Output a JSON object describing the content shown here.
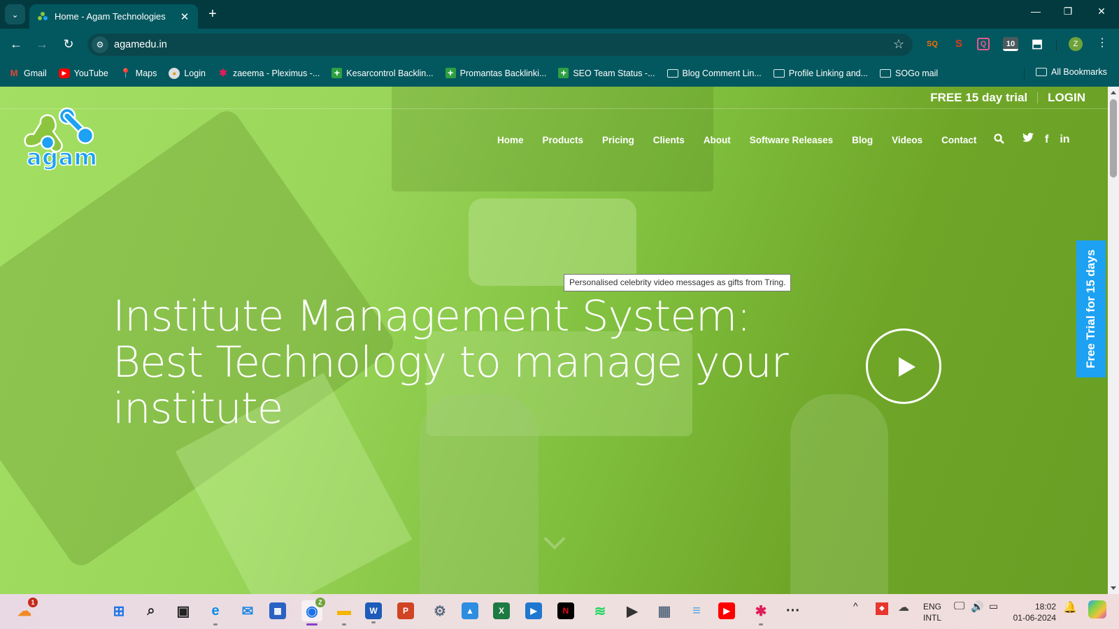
{
  "browser": {
    "tab": {
      "title": "Home - Agam Technologies",
      "close_icon": "close-icon"
    },
    "new_tab_label": "+",
    "window_controls": {
      "minimize": "—",
      "restore": "❐",
      "close": "✕"
    },
    "toolbar": {
      "back": "←",
      "forward": "→",
      "reload": "↻",
      "url": "agamedu.in",
      "star": "☆",
      "extensions": [
        {
          "name": "sq-extension",
          "label": "SQ",
          "color": "#ff6a00"
        },
        {
          "name": "seo-extension",
          "label": "S",
          "color": "#e43a1a"
        },
        {
          "name": "search-extension",
          "label": "Q",
          "color": "#e8598f"
        },
        {
          "name": "ten-extension",
          "label": "10",
          "color": "#ffffff"
        }
      ],
      "puzzle_icon": "⬒",
      "profile_initial": "Z",
      "menu": "⋮"
    },
    "bookmarks": [
      {
        "label": "Gmail",
        "icon": "gmail-icon"
      },
      {
        "label": "YouTube",
        "icon": "youtube-icon"
      },
      {
        "label": "Maps",
        "icon": "maps-icon"
      },
      {
        "label": "Login",
        "icon": "login-icon"
      },
      {
        "label": "zaeema - Pleximus -...",
        "icon": "slack-icon"
      },
      {
        "label": "Kesarcontrol Backlin...",
        "icon": "sheets-plus-icon"
      },
      {
        "label": "Promantas Backlinki...",
        "icon": "sheets-plus-icon"
      },
      {
        "label": "SEO Team Status -...",
        "icon": "sheets-plus-icon"
      },
      {
        "label": "Blog Comment Lin...",
        "icon": "folder-icon"
      },
      {
        "label": "Profile Linking and...",
        "icon": "folder-icon"
      },
      {
        "label": "SOGo mail",
        "icon": "folder-icon"
      }
    ],
    "all_bookmarks": "All Bookmarks"
  },
  "site": {
    "top_links": {
      "trial": "FREE 15 day trial",
      "login": "LOGIN"
    },
    "logo_text": "agam",
    "nav": [
      "Home",
      "Products",
      "Pricing",
      "Clients",
      "About",
      "Software Releases",
      "Blog",
      "Videos",
      "Contact"
    ],
    "socials": {
      "twitter": "🐦",
      "facebook": "f",
      "linkedin": "in"
    },
    "hero_lines": [
      "Institute Management System:",
      "Best Technology to manage your",
      "institute"
    ],
    "tooltip": "Personalised celebrity video messages as gifts from Tring.",
    "side_tab": "Free Trial for 15 days",
    "colors": {
      "accent_blue": "#1da1f2",
      "hero_green": "#8cc63f"
    }
  },
  "taskbar": {
    "weather_badge": "1",
    "apps": [
      {
        "name": "start",
        "glyph": "⊞",
        "color": "#1a73e8"
      },
      {
        "name": "search",
        "glyph": "⌕",
        "color": "#222"
      },
      {
        "name": "task-view",
        "glyph": "▣",
        "color": "#222"
      },
      {
        "name": "edge",
        "glyph": "e",
        "color": "#0c8ee8"
      },
      {
        "name": "mail",
        "glyph": "✉",
        "color": "#1e88e5"
      },
      {
        "name": "store",
        "glyph": "▦",
        "color": "#2a62c4"
      },
      {
        "name": "chrome",
        "glyph": "◉",
        "color": "#1a73e8"
      },
      {
        "name": "file-explorer",
        "glyph": "▬",
        "color": "#f5b400"
      },
      {
        "name": "word",
        "glyph": "W",
        "color": "#1f5bb9"
      },
      {
        "name": "powerpoint",
        "glyph": "P",
        "color": "#d04423"
      },
      {
        "name": "settings",
        "glyph": "⚙",
        "color": "#5a6b80"
      },
      {
        "name": "photos",
        "glyph": "▲",
        "color": "#2d8de0"
      },
      {
        "name": "excel",
        "glyph": "X",
        "color": "#1d7a43"
      },
      {
        "name": "media-player",
        "glyph": "▶",
        "color": "#1f77d0"
      },
      {
        "name": "netflix",
        "glyph": "N",
        "color": "#000000"
      },
      {
        "name": "spotify",
        "glyph": "≋",
        "color": "#1ed760"
      },
      {
        "name": "video-player",
        "glyph": "▶",
        "color": "#333333"
      },
      {
        "name": "calculator",
        "glyph": "▦",
        "color": "#5b6d80"
      },
      {
        "name": "notepad",
        "glyph": "≡",
        "color": "#4fa3e0"
      },
      {
        "name": "youtube",
        "glyph": "▶",
        "color": "#ff0000"
      },
      {
        "name": "slack",
        "glyph": "✱",
        "color": "#e01e5a"
      },
      {
        "name": "more",
        "glyph": "···",
        "color": "#222"
      }
    ],
    "chrome_profile_badge": "Z",
    "tray": {
      "chevron": "^",
      "lang_top": "ENG",
      "lang_bottom": "INTL"
    },
    "time": "18:02",
    "date": "01-06-2024"
  }
}
